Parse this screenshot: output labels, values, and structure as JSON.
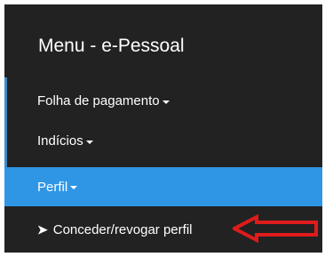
{
  "menu": {
    "title": "Menu - e-Pessoal",
    "items": [
      {
        "label": "Folha de pagamento"
      },
      {
        "label": "Indícios"
      },
      {
        "label": "Perfil",
        "active": true
      }
    ],
    "submenu": {
      "icon": "➤",
      "label": "Conceder/revogar perfil"
    }
  },
  "colors": {
    "background": "#222222",
    "active": "#2f96e6",
    "accent": "#3f89c6",
    "arrow": "#e01b1b"
  },
  "icons": {
    "dropdown": "caret-down-icon",
    "submenu": "chevron-right-icon",
    "annotation": "red-arrow-icon"
  }
}
